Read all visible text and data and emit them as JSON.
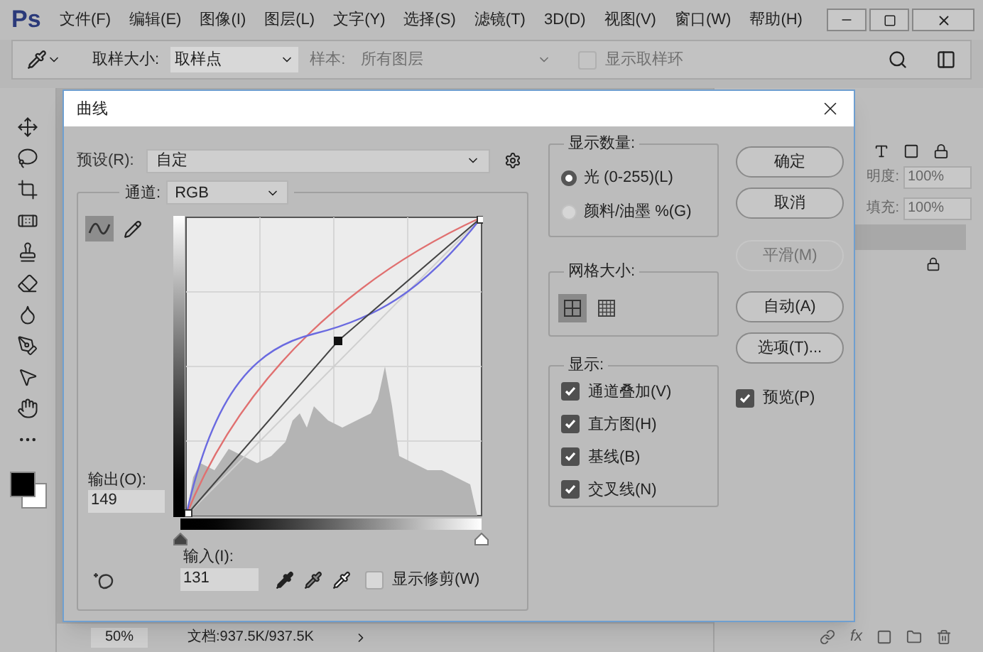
{
  "app": {
    "logo": "Ps",
    "menu": [
      "文件(F)",
      "编辑(E)",
      "图像(I)",
      "图层(L)",
      "文字(Y)",
      "选择(S)",
      "滤镜(T)",
      "3D(D)",
      "视图(V)",
      "窗口(W)",
      "帮助(H)"
    ]
  },
  "options_bar": {
    "sample_size_label": "取样大小:",
    "sample_size": "取样点",
    "sample_label": "样本:",
    "sample": "所有图层",
    "show_ring": {
      "label": "显示取样环",
      "checked": false,
      "disabled": true
    }
  },
  "layers_panel": {
    "opacity_label": "明度:",
    "opacity": "100%",
    "fill_label": "填充:",
    "fill": "100%",
    "fx": "fx"
  },
  "status_bar": {
    "zoom": "50%",
    "document": "文档:937.5K/937.5K"
  },
  "dialog": {
    "title": "曲线",
    "preset_label": "预设(R):",
    "preset": "自定",
    "channel_label": "通道:",
    "channel": "RGB",
    "tools": [
      {
        "kind": "curve",
        "selected": true
      },
      {
        "kind": "pencil",
        "selected": false
      }
    ],
    "input_sliders": [
      {
        "level": 0
      },
      {
        "level": 1
      }
    ],
    "output_label": "输出(O):",
    "output": "149",
    "input_label": "输入(I):",
    "input": "131",
    "show_clipping": {
      "label": "显示修剪(W)",
      "checked": false
    },
    "show_amount": {
      "title": "显示数量:",
      "options": [
        {
          "label": "光 (0-255)(L)",
          "selected": true
        },
        {
          "label": "颜料/油墨 %(G)",
          "selected": false
        }
      ]
    },
    "grid_size": {
      "title": "网格大小:",
      "options": [
        {
          "kind": "coarse",
          "selected": true
        },
        {
          "kind": "fine",
          "selected": false
        }
      ]
    },
    "show": {
      "title": "显示:",
      "options": [
        {
          "label": "通道叠加(V)",
          "checked": true
        },
        {
          "label": "直方图(H)",
          "checked": true
        },
        {
          "label": "基线(B)",
          "checked": true
        },
        {
          "label": "交叉线(N)",
          "checked": true
        }
      ]
    },
    "buttons": [
      {
        "label": "确定",
        "disabled": false
      },
      {
        "label": "取消",
        "disabled": false
      },
      {
        "label": "平滑(M)",
        "disabled": true
      },
      {
        "label": "自动(A)",
        "disabled": false
      },
      {
        "label": "选项(T)...",
        "disabled": false
      }
    ],
    "preview": {
      "label": "预览(P)",
      "checked": true
    }
  }
}
